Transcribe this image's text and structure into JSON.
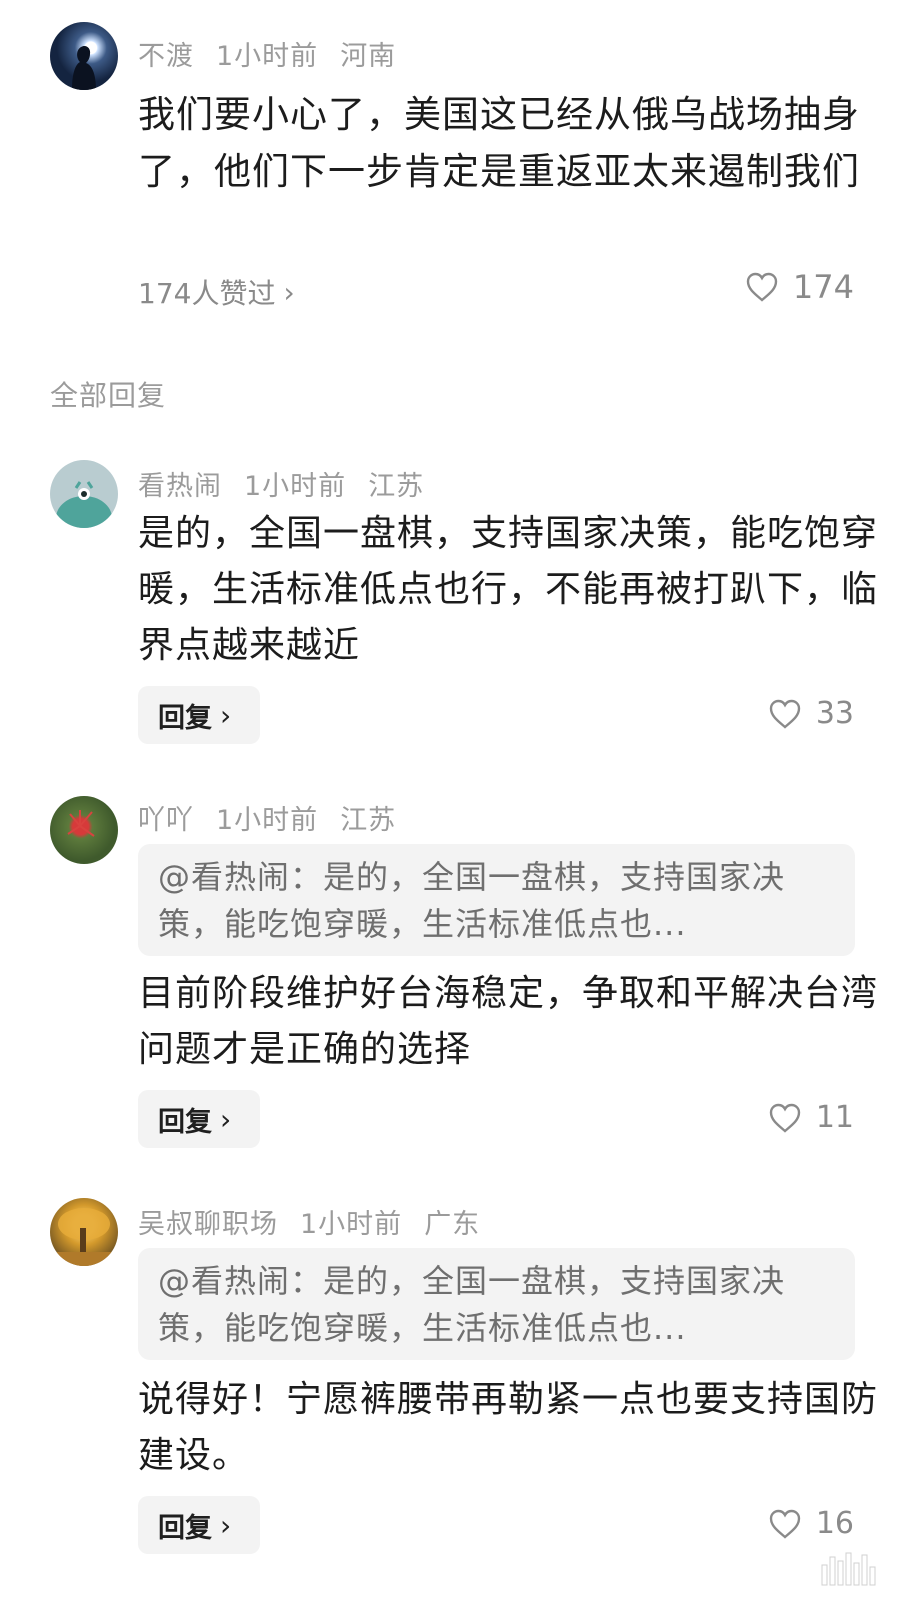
{
  "main_comment": {
    "user": "不渡",
    "time": "1小时前",
    "location": "河南",
    "text": "我们要小心了，美国这已经从俄乌战场抽身了，他们下一步肯定是重返亚太来遏制我们",
    "liked_by": "174人赞过",
    "likes": "174"
  },
  "section_title": "全部回复",
  "replies": [
    {
      "user": "看热闹",
      "time": "1小时前",
      "location": "江苏",
      "text": "是的，全国一盘棋，支持国家决策，能吃饱穿暖，生活标准低点也行，不能再被打趴下，临界点越来越近",
      "reply_label": "回复",
      "likes": "33"
    },
    {
      "user": "吖吖",
      "time": "1小时前",
      "location": "江苏",
      "quote": "@看热闹：是的，全国一盘棋，支持国家决策，能吃饱穿暖，生活标准低点也...",
      "text": "目前阶段维护好台海稳定，争取和平解决台湾问题才是正确的选择",
      "reply_label": "回复",
      "likes": "11"
    },
    {
      "user": "吴叔聊职场",
      "time": "1小时前",
      "location": "广东",
      "quote": "@看热闹：是的，全国一盘棋，支持国家决策，能吃饱穿暖，生活标准低点也...",
      "text": "说得好！宁愿裤腰带再勒紧一点也要支持国防建设。",
      "reply_label": "回复",
      "likes": "16"
    }
  ],
  "icons": {
    "chevron": "chevron-right-icon",
    "heart": "heart-outline-icon"
  },
  "colors": {
    "meta_text": "#9b9b9b",
    "body_text": "#1c1c1c",
    "quote_bg": "#f3f3f3"
  }
}
